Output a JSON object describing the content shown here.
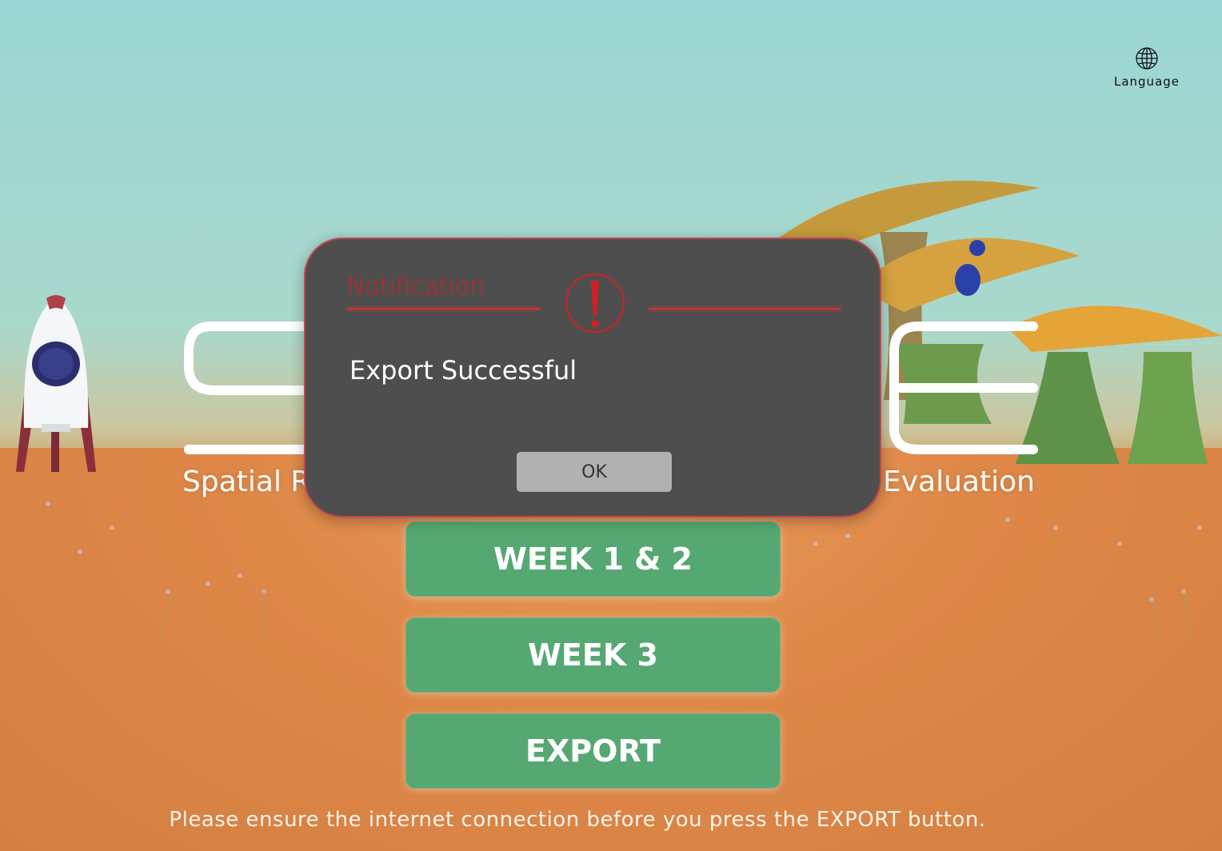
{
  "language": {
    "label": "Language",
    "icon": "globe-icon"
  },
  "logo": {
    "subtitle_left": "Spatial R",
    "subtitle_right": "Evaluation"
  },
  "menu": {
    "week12": "WEEK 1 & 2",
    "week3": "WEEK 3",
    "export": "EXPORT"
  },
  "hint": "Please ensure the internet connection before you press the EXPORT button.",
  "dialog": {
    "title": "Notification",
    "icon": "alert-icon",
    "message": "Export Successful",
    "ok_label": "OK"
  },
  "colors": {
    "button_green": "#56a872",
    "dialog_bg": "#4e4e4e",
    "alert_red": "#d51e24",
    "ok_gray": "#b1b1b1"
  }
}
